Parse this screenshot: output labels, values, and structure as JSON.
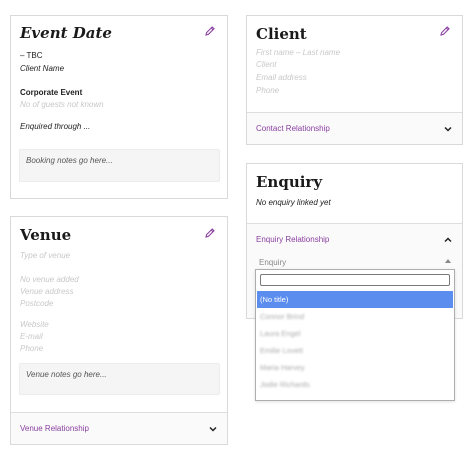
{
  "event": {
    "title": "Event Date",
    "date_line": "– TBC",
    "client_name": "Client Name",
    "event_type": "Corporate Event",
    "guests_placeholder": "No of guests not known",
    "enquired": "Enquired through ...",
    "notes_placeholder": "Booking notes go here..."
  },
  "venue": {
    "title": "Venue",
    "type_placeholder": "Type of venue",
    "address_lines": [
      "No venue added",
      "Venue address",
      "Postcode"
    ],
    "contact_lines": [
      "Website",
      "E-mail",
      "Phone"
    ],
    "notes_placeholder": "Venue notes go here...",
    "relationship_label": "Venue Relationship"
  },
  "client": {
    "title": "Client",
    "placeholders": [
      "First name – Last name",
      "Client",
      "Email address",
      "Phone"
    ],
    "relationship_label": "Contact Relationship"
  },
  "enquiry": {
    "title": "Enquiry",
    "empty_text": "No enquiry linked yet",
    "relationship_label": "Enquiry Relationship",
    "select_value": "Enquiry",
    "options": [
      "(No title)",
      "Connor Brind",
      "Laura Engel",
      "Emilie Lovett",
      "Maria Harvey",
      "Jodie Richards"
    ]
  },
  "colors": {
    "accent": "#8a3fa0",
    "selected_option": "#5b8def"
  },
  "icons": {
    "edit": "pencil-icon",
    "expand": "chevron-down-icon",
    "collapse": "chevron-up-icon",
    "select_arrow": "triangle-up-icon"
  }
}
